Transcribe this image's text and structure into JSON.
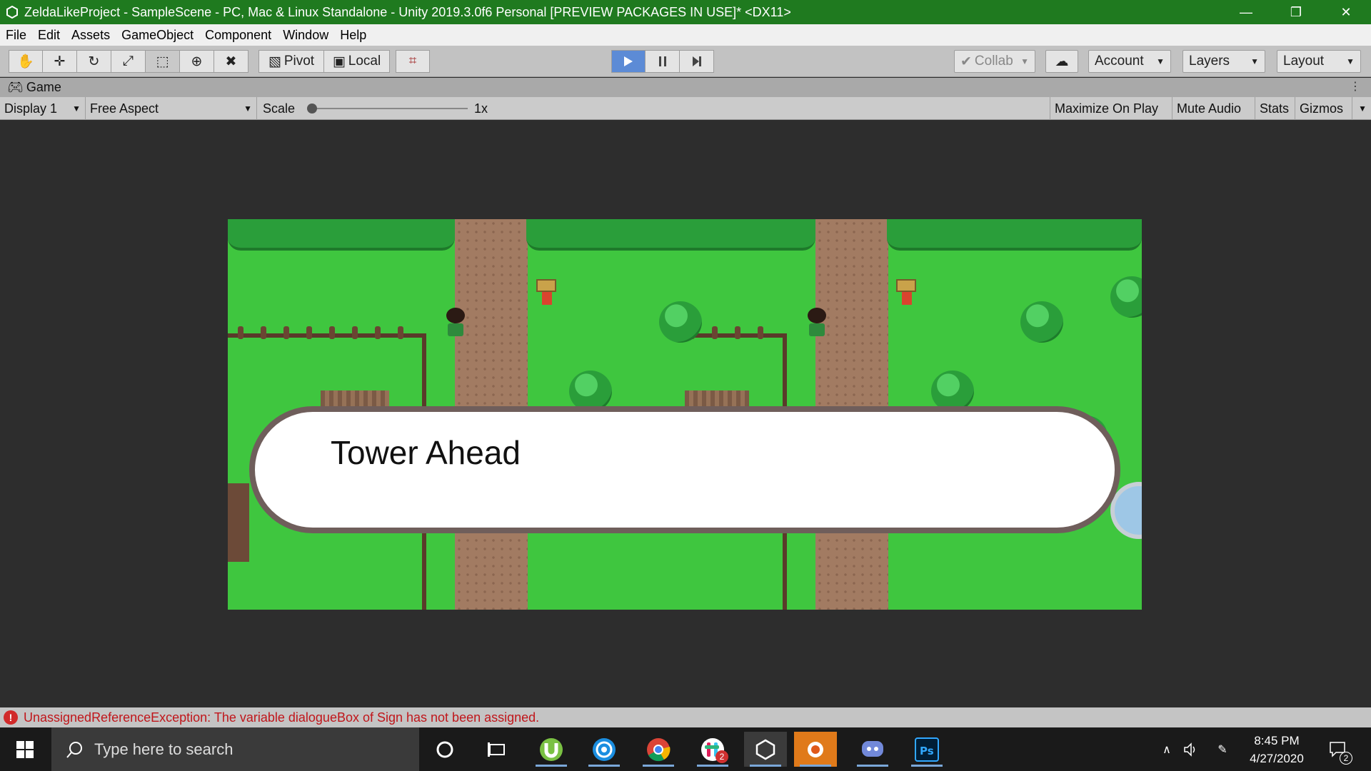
{
  "window": {
    "title": "ZeldaLikeProject - SampleScene - PC, Mac & Linux Standalone - Unity 2019.3.0f6 Personal [PREVIEW PACKAGES IN USE]* <DX11>",
    "controls": [
      "minimize",
      "restore",
      "close"
    ]
  },
  "menu": {
    "items": [
      "File",
      "Edit",
      "Assets",
      "GameObject",
      "Component",
      "Window",
      "Help"
    ]
  },
  "toolbar": {
    "tools": [
      "hand-tool",
      "move-tool",
      "rotate-tool",
      "scale-tool",
      "rect-tool",
      "transform-tool",
      "custom-tool"
    ],
    "pivot_label": "Pivot",
    "local_label": "Local",
    "collab_label": "Collab",
    "account_label": "Account",
    "layers_label": "Layers",
    "layout_label": "Layout",
    "play_active": true,
    "colors": {
      "play_accent": "#5c8bd6",
      "titlebar": "#1f7a1f"
    }
  },
  "tab": {
    "label": "Game"
  },
  "gamebar": {
    "display": "Display 1",
    "aspect": "Free Aspect",
    "scale_label": "Scale",
    "scale_value": "1x",
    "scale_fraction": 0.0,
    "maximize": "Maximize On Play",
    "mute": "Mute Audio",
    "stats": "Stats",
    "gizmos": "Gizmos"
  },
  "game": {
    "dialogue_text": "Tower Ahead"
  },
  "status": {
    "message": "UnassignedReferenceException: The variable dialogueBox of Sign has not been assigned.",
    "color": "#c0161b"
  },
  "taskbar": {
    "search_placeholder": "Type here to search",
    "apps": [
      "cortana-icon",
      "task-view-icon",
      "utorrent-icon",
      "uplay-icon",
      "chrome-icon",
      "slack-icon",
      "unity-icon",
      "blender-icon",
      "discord-icon",
      "photoshop-icon"
    ],
    "slack_badge": "2",
    "time": "8:45 PM",
    "date": "4/27/2020",
    "notification_count": "2"
  }
}
